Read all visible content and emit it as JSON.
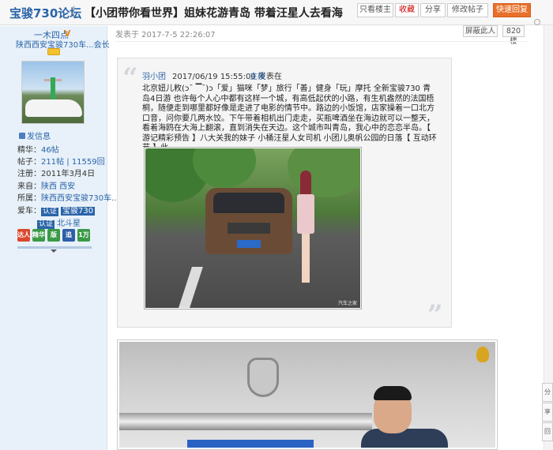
{
  "header": {
    "forum_name": "宝骏730论坛",
    "separator": "|",
    "thread_title": "【小团带你看世界】姐妹花游青岛 带着汪星人去看海",
    "buttons": {
      "only_author": "只看楼主",
      "favorite": "收藏",
      "share": "分享",
      "edit": "修改帖子",
      "quick_reply": "快速回复"
    }
  },
  "sidebar": {
    "username": "一木四点",
    "verified_mark": "V",
    "user_group": "陕西西安宝骏730车...会长",
    "send_message": "发信息",
    "stats": {
      "essence_label": "精华：",
      "essence_value": "46帖",
      "posts_label": "帖子：",
      "posts_value": "211帖 | 11559回",
      "register_label": "注册：",
      "register_value": "2011年3月4日",
      "from_label": "来自：",
      "from_value": "陕西 西安",
      "club_label": "所属：",
      "club_value": "陕西西安宝骏730车...",
      "car_label": "爱车：",
      "tag_label": "认证",
      "car_value_1": "宝骏730",
      "car_value_2": "北斗星"
    },
    "medals": [
      {
        "label": "达人",
        "color": "#d9492e"
      },
      {
        "label": "精华",
        "color": "#3a9a46"
      },
      {
        "label": "版",
        "color": "#3a9a46"
      },
      {
        "label": "追",
        "color": "#2e5fa8"
      },
      {
        "label": "1万",
        "color": "#3a9a46"
      }
    ]
  },
  "post": {
    "meta": "发表于 2017-7-5 22:26:07",
    "author_filter": "屏蔽此人",
    "floor": "820楼",
    "quote": {
      "author": "羽小团",
      "date": "2017/06/19 15:55:00 发表在",
      "location": "主楼",
      "text": "北京妞儿敉(ↄ¯ ▔¯)ↄ「爱」猫咪「梦」旅行「善」健身「玩」摩托 全新宝骏730 青岛4日游 也许每个人心中都有这样一个城，有高低起伏的小路，有生机盎然的法国梧桐，随便走到哪里都好像是走进了电影的情节中。路边的小饭馆，店家操着一口北方口音，问你要几两水饺。下午带着相机出门走走，买瓶啤酒坐在海边就可以一整天，看着海鸥在大海上翻滚，直到消失在天边。这个城市叫青岛，我心中的恋恋半岛。【 游记精彩预告 】八大关我的妹子 小桶汪星人女司机 小团儿奥帆公园的日落【 互动环节 】此...",
      "photo_watermark": "汽车之家"
    }
  },
  "right_tabs": [
    "分",
    "享",
    "回"
  ]
}
